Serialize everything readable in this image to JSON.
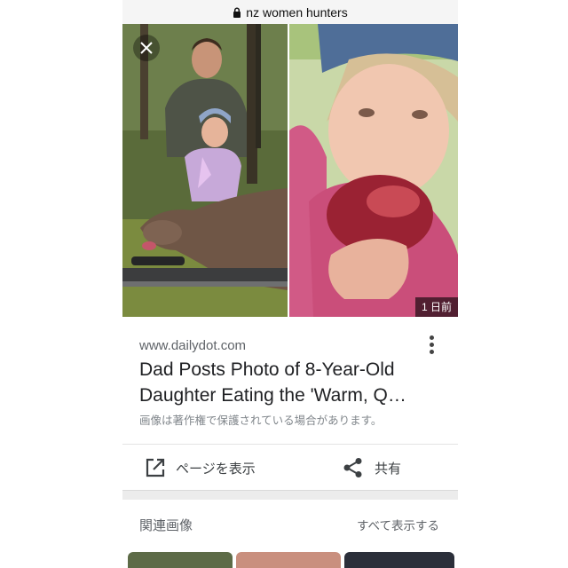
{
  "urlbar": {
    "query": "nz women hunters",
    "icon": "lock-icon"
  },
  "image": {
    "age_badge": "1 日前",
    "close_icon": "close-icon"
  },
  "result": {
    "source": "www.dailydot.com",
    "title_line1": "Dad Posts Photo of 8-Year-Old",
    "title_line2": "Daughter Eating the 'Warm, Q…",
    "copyright": "画像は著作権で保護されている場合があります。",
    "more_icon": "more-vert-icon"
  },
  "actions": {
    "view_page": "ページを表示",
    "share": "共有",
    "view_icon": "open-in-new-icon",
    "share_icon": "share-icon"
  },
  "related": {
    "title": "関連画像",
    "view_all": "すべて表示する"
  },
  "colors": {
    "text": "#202124",
    "secondary": "#5f6368",
    "muted": "#80868b"
  }
}
